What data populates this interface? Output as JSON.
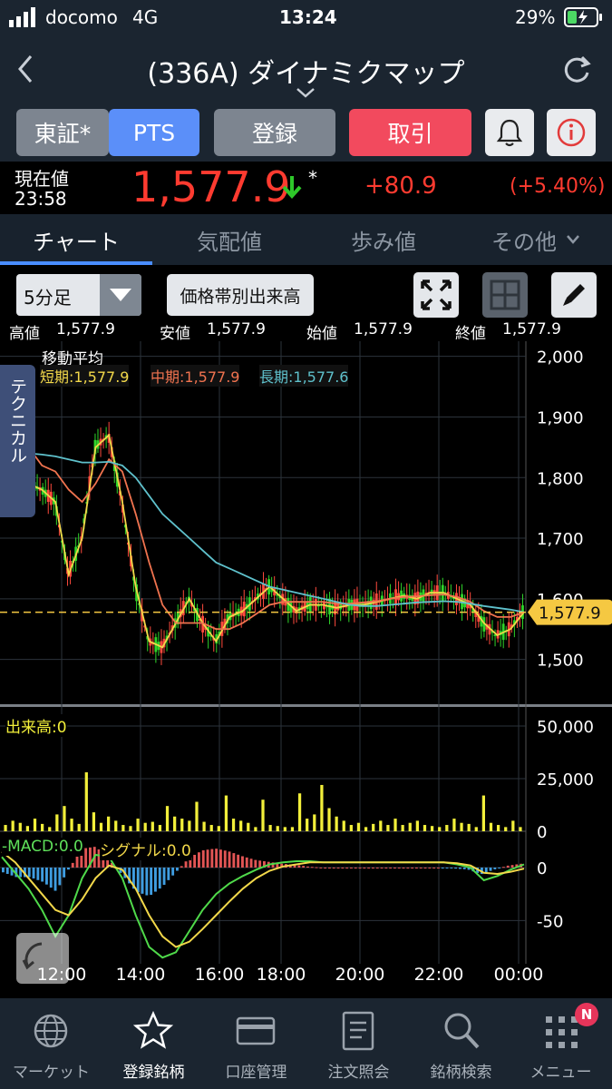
{
  "status": {
    "carrier": "docomo",
    "network": "4G",
    "time": "13:24",
    "battery": "29%"
  },
  "nav": {
    "title": "(336A) ダイナミクマップ"
  },
  "market": {
    "tse": "東証*",
    "pts": "PTS",
    "register": "登録",
    "trade": "取引"
  },
  "price": {
    "label": "現在値",
    "time": "23:58",
    "value": "1,577.9",
    "mark": "*",
    "change": "+80.9",
    "change_pct": "(+5.40%)"
  },
  "tabs": [
    "チャート",
    "気配値",
    "歩み値",
    "その他"
  ],
  "chart_controls": {
    "interval": "5分足",
    "volume_button": "価格帯別出来高"
  },
  "ohlc": {
    "high_label": "高値",
    "high": "1,577.9",
    "low_label": "安値",
    "low": "1,577.9",
    "open_label": "始値",
    "open": "1,577.9",
    "close_label": "終値",
    "close": "1,577.9"
  },
  "ma": {
    "title": "移動平均",
    "short": "短期:1,577.9",
    "mid": "中期:1,577.9",
    "long": "長期:1,577.6"
  },
  "technical_tab": "テクニカル",
  "volume_label": "出来高:0",
  "macd": {
    "macd": "-MACD:0.0",
    "signal": "シグナル:0.0"
  },
  "colors": {
    "up": "#ff4a3d",
    "down": "#2fd52a",
    "short_ma": "#f2d84a",
    "mid_ma": "#f0734f",
    "long_ma": "#5fc1cc",
    "volume": "#f2ef3a",
    "current": "#f5c842",
    "accent": "#4a8dff"
  },
  "bottom_nav": [
    "マーケット",
    "登録銘柄",
    "口座管理",
    "注文照会",
    "銘柄検索",
    "メニュー"
  ],
  "badge": "N",
  "chart_data": [
    {
      "type": "line",
      "title": "",
      "x_ticks": [
        "12:00",
        "14:00",
        "16:00",
        "18:00",
        "20:00",
        "22:00",
        "00:00"
      ],
      "y_ticks": [
        1500,
        1600,
        1700,
        1800,
        1900,
        2000
      ],
      "ylim": [
        1450,
        2010
      ],
      "current_price": 1577.9,
      "series": [
        {
          "name": "短期",
          "values": [
            1900,
            1820,
            1790,
            1780,
            1760,
            1640,
            1700,
            1850,
            1870,
            1760,
            1620,
            1530,
            1520,
            1560,
            1600,
            1560,
            1530,
            1570,
            1580,
            1600,
            1620,
            1600,
            1580,
            1590,
            1590,
            1585,
            1590,
            1590,
            1595,
            1600,
            1605,
            1600,
            1610,
            1610,
            1600,
            1590,
            1560,
            1540,
            1550,
            1578
          ]
        },
        {
          "name": "中期",
          "values": [
            1880,
            1860,
            1850,
            1820,
            1810,
            1780,
            1760,
            1790,
            1830,
            1810,
            1740,
            1660,
            1590,
            1560,
            1560,
            1560,
            1550,
            1550,
            1560,
            1575,
            1590,
            1595,
            1595,
            1595,
            1595,
            1592,
            1592,
            1594,
            1596,
            1600,
            1603,
            1604,
            1606,
            1607,
            1603,
            1595,
            1580,
            1570,
            1570,
            1578
          ]
        },
        {
          "name": "長期",
          "values": [
            1840,
            1840,
            1840,
            1838,
            1835,
            1830,
            1825,
            1825,
            1826,
            1820,
            1800,
            1770,
            1740,
            1720,
            1700,
            1680,
            1660,
            1650,
            1640,
            1630,
            1620,
            1615,
            1610,
            1605,
            1600,
            1595,
            1590,
            1588,
            1588,
            1590,
            1592,
            1594,
            1595,
            1596,
            1595,
            1592,
            1588,
            1585,
            1582,
            1578
          ]
        }
      ]
    },
    {
      "type": "bar",
      "title": "",
      "y_ticks": [
        0,
        25000,
        50000
      ],
      "ylim": [
        0,
        50000
      ],
      "values": [
        3000,
        5000,
        4000,
        2500,
        6000,
        3500,
        2000,
        8000,
        12000,
        6000,
        3500,
        28000,
        9000,
        4000,
        7000,
        5000,
        3000,
        2500,
        6000,
        4000,
        4500,
        3000,
        12000,
        7000,
        6000,
        5000,
        14000,
        4500,
        3000,
        2500,
        17000,
        6000,
        5000,
        4000,
        2000,
        15000,
        3000,
        2500,
        2000,
        2000,
        18000,
        6000,
        8000,
        22000,
        11000,
        7000,
        5000,
        3000,
        4000,
        2000,
        3500,
        5000,
        3000,
        6000,
        3000,
        4000,
        5000,
        3000,
        2500,
        2000,
        3000,
        6000,
        4000,
        3500,
        2000,
        17000,
        4000,
        3000,
        2000,
        5000,
        2000
      ]
    },
    {
      "type": "line",
      "title": "",
      "y_ticks": [
        0,
        -50
      ],
      "ylim": [
        -90,
        30
      ],
      "series": [
        {
          "name": "MACD",
          "values": [
            10,
            -5,
            -20,
            -40,
            -65,
            -45,
            -10,
            12,
            10,
            -10,
            -45,
            -75,
            -85,
            -80,
            -60,
            -40,
            -25,
            -15,
            -8,
            -2,
            3,
            5,
            6,
            6,
            5,
            5,
            5,
            5,
            5,
            5,
            5,
            5,
            5,
            5,
            3,
            0,
            -12,
            -8,
            -2,
            3
          ]
        },
        {
          "name": "シグナル",
          "values": [
            15,
            5,
            -10,
            -25,
            -40,
            -45,
            -30,
            -10,
            2,
            -2,
            -20,
            -45,
            -65,
            -75,
            -70,
            -58,
            -45,
            -32,
            -20,
            -10,
            -3,
            1,
            3,
            5,
            5,
            5,
            5,
            5,
            5,
            5,
            5,
            5,
            5,
            5,
            4,
            2,
            -5,
            -6,
            -4,
            -1
          ]
        }
      ]
    }
  ]
}
